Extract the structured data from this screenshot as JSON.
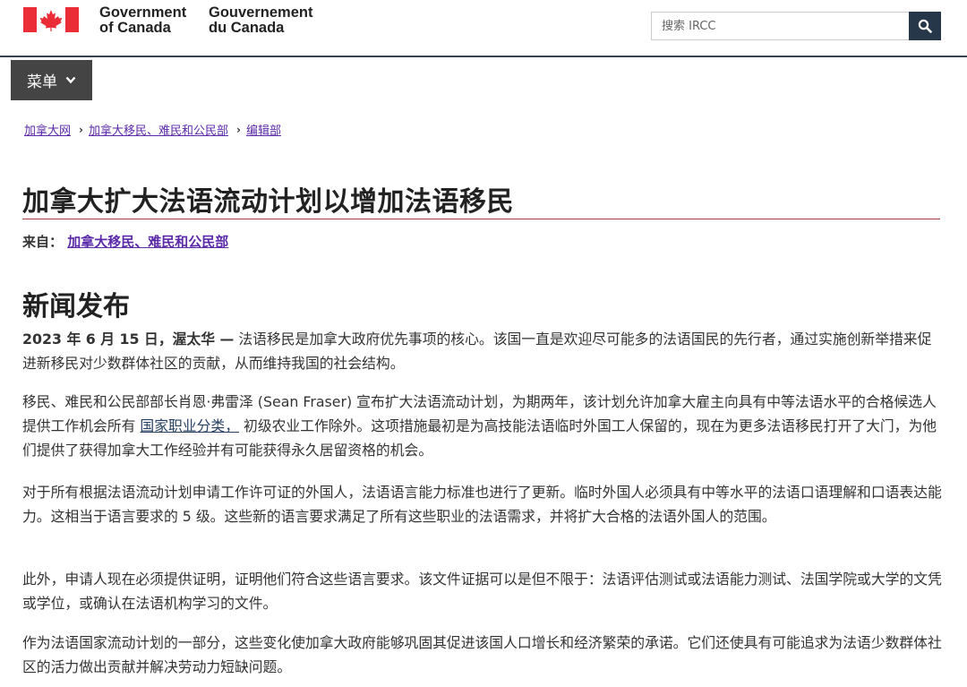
{
  "header": {
    "signature_en_line1": "Government",
    "signature_en_line2": "of Canada",
    "signature_fr_line1": "Gouvernement",
    "signature_fr_line2": "du Canada",
    "search_placeholder": "搜索 IRCC"
  },
  "menu": {
    "label": "菜单"
  },
  "breadcrumb": [
    {
      "label": "加拿大网"
    },
    {
      "label": "加拿大移民、难民和公民部"
    },
    {
      "label": "编辑部"
    }
  ],
  "page": {
    "title": "加拿大扩大法语流动计划以增加法语移民",
    "from_label": "来自：",
    "from_link": "加拿大移民、难民和公民部",
    "section_title": "新闻发布"
  },
  "paragraphs": {
    "p1_dateline": "2023 年 6 月 15 日，渥太华 —",
    "p1_text": " 法语移民是加拿大政府优先事项的核心。该国一直是欢迎尽可能多的法语国民的先行者，通过实施创新举措来促进新移民对少数群体社区的贡献，从而维持我国的社会结构。",
    "p2_before": "移民、难民和公民部部长肖恩·弗雷泽 (Sean Fraser) 宣布扩大法语流动计划，为期两年，该计划允许加拿大雇主向具有中等法语水平的合格候选人提供工作机会所有 ",
    "p2_link": "国家职业分类，",
    "p2_after": " 初级农业工作除外。这项措施最初是为高技能法语临时外国工人保留的，现在为更多法语移民打开了大门，为他们提供了获得加拿大工作经验并有可能获得永久居留资格的机会。",
    "p3": "对于所有根据法语流动计划申请工作许可证的外国人，法语语言能力标准也进行了更新。临时外国人必须具有中等水平的法语口语理解和口语表达能力。这相当于语言要求的 5 级。这些新的语言要求满足了所有这些职业的法语需求，并将扩大合格的法语外国人的范围。",
    "p4": "此外，申请人现在必须提供证明，证明他们符合这些语言要求。该文件证据可以是但不限于：法语评估测试或法语能力测试、法国学院或大学的文凭或学位，或确认在法语机构学习的文件。",
    "p5": "作为法语国家流动计划的一部分，这些变化使加拿大政府能够巩固其促进该国人口增长和经济繁荣的承诺。它们还使具有可能追求为法语少数群体社区的活力做出贡献并解决劳动力短缺问题。"
  },
  "colors": {
    "flag_red": "#eb2d37",
    "nav_dark": "#26374a",
    "menu_bg": "#444444",
    "link_visited": "#5b2aa8",
    "title_rule": "#af3c43"
  }
}
